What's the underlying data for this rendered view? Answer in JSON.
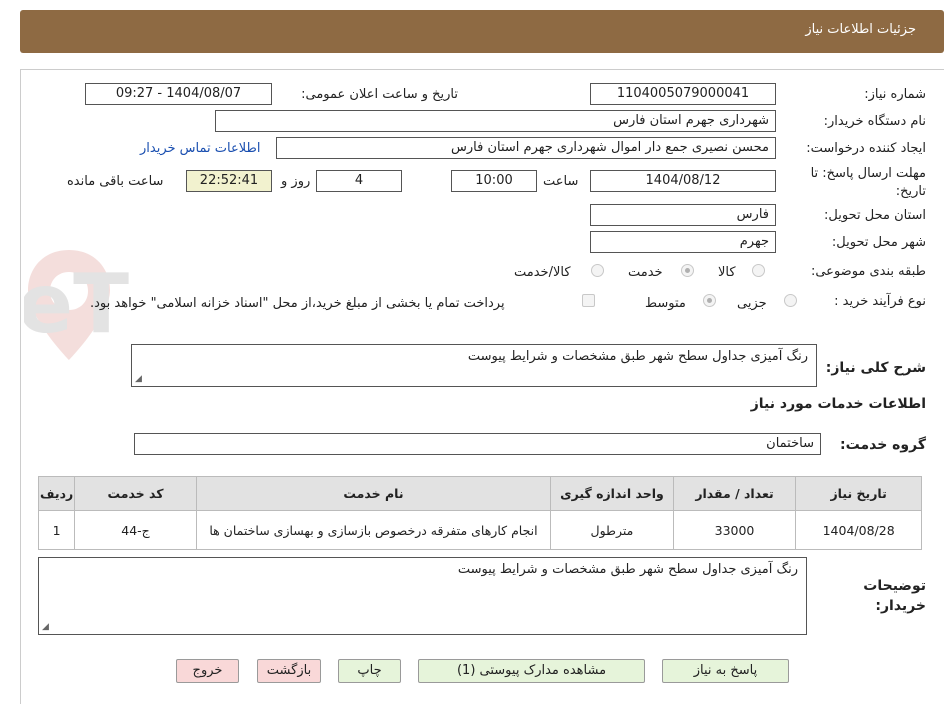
{
  "header": {
    "title": "جزئيات اطلاعات نياز"
  },
  "form": {
    "need_number": {
      "label": "شماره نیاز:",
      "value": "1104005079000041"
    },
    "announce_datetime": {
      "label": "تاریخ و ساعت اعلان عمومی:",
      "value": "1404/08/07 - 09:27"
    },
    "buyer_org": {
      "label": "نام دستگاه خریدار:",
      "value": "شهرداری جهرم استان فارس"
    },
    "requester": {
      "label": "ایجاد کننده درخواست:",
      "value": "محسن نصیری جمع دار اموال  شهرداری جهرم استان فارس"
    },
    "buyer_contact_link": "اطلاعات تماس خریدار",
    "deadline": {
      "label": "مهلت ارسال پاسخ: تا تاریخ:",
      "date": "1404/08/12",
      "time_label": "ساعت",
      "time": "10:00",
      "days": "4",
      "days_label": "روز و",
      "remaining": "22:52:41",
      "remaining_label": "ساعت باقی مانده"
    },
    "province": {
      "label": "استان محل تحویل:",
      "value": "فارس"
    },
    "city": {
      "label": "شهر محل تحویل:",
      "value": "جهرم"
    },
    "category": {
      "label": "طبقه بندی موضوعی:",
      "options": [
        "کالا",
        "خدمت",
        "کالا/خدمت"
      ],
      "selected": "خدمت"
    },
    "process": {
      "label": "نوع فرآیند خرید :",
      "options": [
        "جزیی",
        "متوسط"
      ],
      "selected": "متوسط",
      "payment_note": "پرداخت تمام یا بخشی از مبلغ خرید،از محل \"اسناد خزانه اسلامی\" خواهد بود."
    }
  },
  "summary": {
    "label": "شرح کلی نیاز:",
    "value": "رنگ آمیزی جداول سطح شهر طبق مشخصات و شرایط پیوست"
  },
  "services_section": {
    "title": "اطلاعات خدمات مورد نیاز",
    "group_label": "گروه خدمت:",
    "group_value": "ساختمان"
  },
  "table": {
    "headers": [
      "ردیف",
      "کد خدمت",
      "نام خدمت",
      "واحد اندازه گیری",
      "تعداد / مقدار",
      "تاریخ نیاز"
    ],
    "rows": [
      [
        "1",
        "ج-44",
        "انجام کارهای متفرقه درخصوص بازسازی و بهسازی ساختمان ها",
        "مترطول",
        "33000",
        "1404/08/28"
      ]
    ]
  },
  "buyer_notes": {
    "label": "توضیحات خریدار:",
    "value": "رنگ آمیزی جداول سطح شهر طبق مشخصات و شرایط پیوست"
  },
  "buttons": {
    "reply": "پاسخ به نیاز",
    "attachments": "مشاهده مدارک پیوستی (1)",
    "print": "چاپ",
    "back": "بازگشت",
    "exit": "خروج"
  },
  "watermark": {
    "text": "AriaTender.neT"
  },
  "colors": {
    "header_bg": "#8e6a43",
    "button_green": "#e6f4da",
    "button_red": "#f9d8d8",
    "link": "#1a4fb0",
    "highlight": "#f2f2cf"
  }
}
